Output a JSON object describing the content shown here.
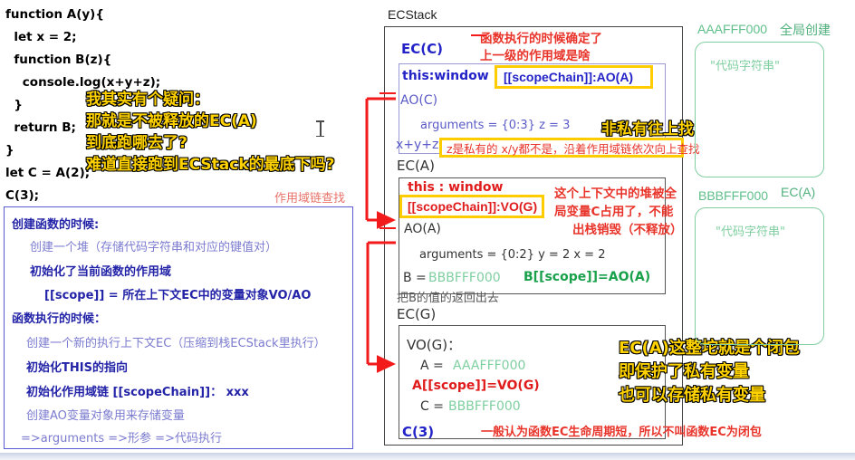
{
  "code_block": {
    "lines": [
      "function A(y){",
      "  let x = 2;",
      "  function B(z){",
      "    console.log(x+y+z);",
      "  }",
      "  return B;",
      "}",
      "let C = A(2);",
      "C(3);"
    ]
  },
  "annotations": {
    "question": [
      "我其实有个疑问：",
      "那就是不被释放的EC(A)",
      "到底跑哪去了?",
      "难道直接跑到ECStack的最底下吗?"
    ],
    "non_private": "非私有往上找",
    "closure": [
      "EC(A)这整坨就是个闭包",
      "即保护了私有变量",
      "也可以存储私有变量"
    ],
    "scope_lookup": "作用域链查找",
    "exec_determines": [
      "函数执行的时候确定了",
      "上一级的作用域是啥"
    ],
    "heap_occupied": [
      "这个上下文中的堆被全",
      "局变量C占用了，不能",
      "出栈销毁（不释放）"
    ],
    "lifecycle": "一般认为函数EC生命周期短，所以不叫函数EC为闭包"
  },
  "notes_box": {
    "lines": [
      {
        "text": "创建函数的时候:",
        "style": "head"
      },
      {
        "text": "创建一个堆（存储代码字符串和对应的键值对）",
        "style": "sub-a"
      },
      {
        "text": "初始化了当前函数的作用域",
        "style": "sub-b"
      },
      {
        "text": "[[scope]] = 所在上下文EC中的变量对象VO/AO",
        "style": "sub-b"
      },
      {
        "text": "函数执行的时候：",
        "style": "head"
      },
      {
        "text": "创建一个新的执行上下文EC（压缩到栈ECStack里执行）",
        "style": "sub-a"
      },
      {
        "text": "初始化THIS的指向",
        "style": "sub-b"
      },
      {
        "text": "初始化作用域链 [[scopeChain]]： xxx",
        "style": "sub-b"
      },
      {
        "text": "创建AO变量对象用来存储变量",
        "style": "sub-c"
      },
      {
        "text": "=>arguments    =>形参   =>代码执行",
        "style": "sub-c"
      }
    ]
  },
  "ecstack": {
    "label": "ECStack",
    "frames": [
      {
        "title": "EC(C)",
        "this": "this:window",
        "scope_chain": "[[scopeChain]]:AO(A)",
        "ao_label": "AO(C)",
        "arguments": "arguments = {0:3}    z = 3",
        "expression": "x+y+z",
        "private_note": "z是私有的   x/y都不是，沿着作用域链依次向上查找"
      },
      {
        "title": "EC(A)",
        "this": "this : window",
        "scope_chain": "[[scopeChain]]:VO(G)",
        "ao_label": "AO(A)",
        "arguments": "arguments = {0:2}   y = 2   x = 2",
        "b_assign_name": "B =",
        "b_assign_value": "BBBFFF000",
        "b_scope": "B[[scope]]=AO(A)",
        "return_note": "把B的值的返回出去"
      },
      {
        "title": "EC(G)",
        "vo_label": "VO(G)：",
        "a_assign_name": "A =",
        "a_assign_value": "AAAFFF000",
        "a_scope": "A[[scope]]=VO(G)",
        "c_assign_name": "C =",
        "c_assign_value": "BBBFFF000",
        "call": "C(3)"
      }
    ]
  },
  "heap": {
    "items": [
      {
        "address": "AAAFFF000",
        "owner": "全局创建",
        "content": "\"代码字符串\""
      },
      {
        "address": "BBBFFF000",
        "owner": "EC(A)",
        "content": "\"代码字符串\""
      }
    ]
  },
  "colors": {
    "yellow_highlight": "#ffcc00",
    "red_annotation": "#e8342a",
    "blue_text": "#2323c8",
    "green_heap": "#7fcfa0",
    "purple_border": "#5b5bd6"
  }
}
